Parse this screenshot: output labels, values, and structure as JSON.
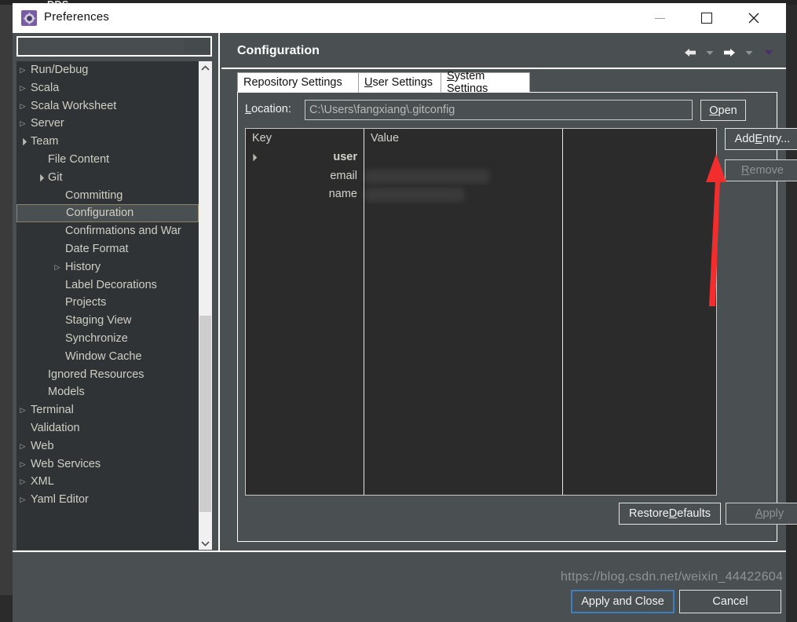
{
  "background": {
    "window_label": "DDS"
  },
  "window": {
    "title": "Preferences",
    "icon": "gear-icon",
    "controls": {
      "minimize": "minimize-icon",
      "maximize": "maximize-icon",
      "close": "close-icon"
    }
  },
  "sidebar": {
    "filter": {
      "value": "",
      "placeholder": ""
    },
    "tree": [
      {
        "label": "Run/Debug",
        "indent": 0,
        "arrow": "collapsed",
        "selected": false
      },
      {
        "label": "Scala",
        "indent": 0,
        "arrow": "collapsed",
        "selected": false
      },
      {
        "label": "Scala Worksheet",
        "indent": 0,
        "arrow": "collapsed",
        "selected": false
      },
      {
        "label": "Server",
        "indent": 0,
        "arrow": "collapsed",
        "selected": false
      },
      {
        "label": "Team",
        "indent": 0,
        "arrow": "expanded",
        "selected": false
      },
      {
        "label": "File Content",
        "indent": 1,
        "arrow": "none",
        "selected": false
      },
      {
        "label": "Git",
        "indent": 1,
        "arrow": "expanded",
        "selected": false
      },
      {
        "label": "Committing",
        "indent": 2,
        "arrow": "none",
        "selected": false
      },
      {
        "label": "Configuration",
        "indent": 2,
        "arrow": "none",
        "selected": true
      },
      {
        "label": "Confirmations and War",
        "indent": 2,
        "arrow": "none",
        "selected": false
      },
      {
        "label": "Date Format",
        "indent": 2,
        "arrow": "none",
        "selected": false
      },
      {
        "label": "History",
        "indent": 2,
        "arrow": "collapsed",
        "selected": false
      },
      {
        "label": "Label Decorations",
        "indent": 2,
        "arrow": "none",
        "selected": false
      },
      {
        "label": "Projects",
        "indent": 2,
        "arrow": "none",
        "selected": false
      },
      {
        "label": "Staging View",
        "indent": 2,
        "arrow": "none",
        "selected": false
      },
      {
        "label": "Synchronize",
        "indent": 2,
        "arrow": "none",
        "selected": false
      },
      {
        "label": "Window Cache",
        "indent": 2,
        "arrow": "none",
        "selected": false
      },
      {
        "label": "Ignored Resources",
        "indent": 1,
        "arrow": "none",
        "selected": false
      },
      {
        "label": "Models",
        "indent": 1,
        "arrow": "none",
        "selected": false
      },
      {
        "label": "Terminal",
        "indent": 0,
        "arrow": "collapsed",
        "selected": false
      },
      {
        "label": "Validation",
        "indent": 0,
        "arrow": "none",
        "selected": false
      },
      {
        "label": "Web",
        "indent": 0,
        "arrow": "collapsed",
        "selected": false
      },
      {
        "label": "Web Services",
        "indent": 0,
        "arrow": "collapsed",
        "selected": false
      },
      {
        "label": "XML",
        "indent": 0,
        "arrow": "collapsed",
        "selected": false
      },
      {
        "label": "Yaml Editor",
        "indent": 0,
        "arrow": "collapsed",
        "selected": false
      }
    ],
    "scrollbars": {
      "vertical_up": "chevron-up-icon",
      "vertical_down": "chevron-down-icon",
      "horizontal_left": "chevron-left-icon",
      "horizontal_right": "chevron-right-icon"
    },
    "bottom_icons": [
      {
        "name": "help-icon"
      },
      {
        "name": "import-icon"
      },
      {
        "name": "export-icon"
      },
      {
        "name": "circle-icon"
      }
    ]
  },
  "content": {
    "title": "Configuration",
    "nav": {
      "back": "back-arrow-icon",
      "back_menu": "chevron-down-icon",
      "forward": "forward-arrow-icon",
      "forward_menu": "chevron-down-icon",
      "view_menu": "view-menu-icon"
    },
    "tabs": [
      {
        "label": "Repository Settings",
        "mnemonic": "",
        "active": false
      },
      {
        "label": "User Settings",
        "mnemonic": "U",
        "active": true
      },
      {
        "label": "System Settings",
        "mnemonic": "S",
        "active": false
      }
    ],
    "location": {
      "label": "Location:",
      "mnemonic": "L",
      "value": "C:\\Users\\fangxiang\\.gitconfig",
      "open_label": "Open",
      "open_mnemonic": "O"
    },
    "table": {
      "columns": [
        "Key",
        "Value",
        ""
      ],
      "rows": [
        {
          "key": "user",
          "value": "",
          "group": true,
          "redacted": false,
          "redact_width": 0
        },
        {
          "key": "email",
          "value": "",
          "group": false,
          "redacted": true,
          "redact_width": 160
        },
        {
          "key": "name",
          "value": "",
          "group": false,
          "redacted": true,
          "redact_width": 128
        }
      ],
      "empty_rows": 16
    },
    "buttons": {
      "add_entry": "Add Entry...",
      "add_entry_mnemonic": "E",
      "remove": "Remove",
      "remove_mnemonic": "R",
      "remove_enabled": false,
      "restore_defaults": "Restore Defaults",
      "restore_mnemonic": "D",
      "apply": "Apply",
      "apply_mnemonic": "A",
      "apply_enabled": false
    }
  },
  "footer": {
    "apply_and_close": "Apply and Close",
    "cancel": "Cancel"
  },
  "watermark": "https://blog.csdn.net/weixin_44422604",
  "colors": {
    "dialog_bg": "#4a5052",
    "tree_bg": "#2f3335",
    "table_cell_bg": "#2b2b2b",
    "accent_focus": "#3d7fc1",
    "annotation_red": "#f22d2d",
    "title_bar": "#ffffff"
  }
}
